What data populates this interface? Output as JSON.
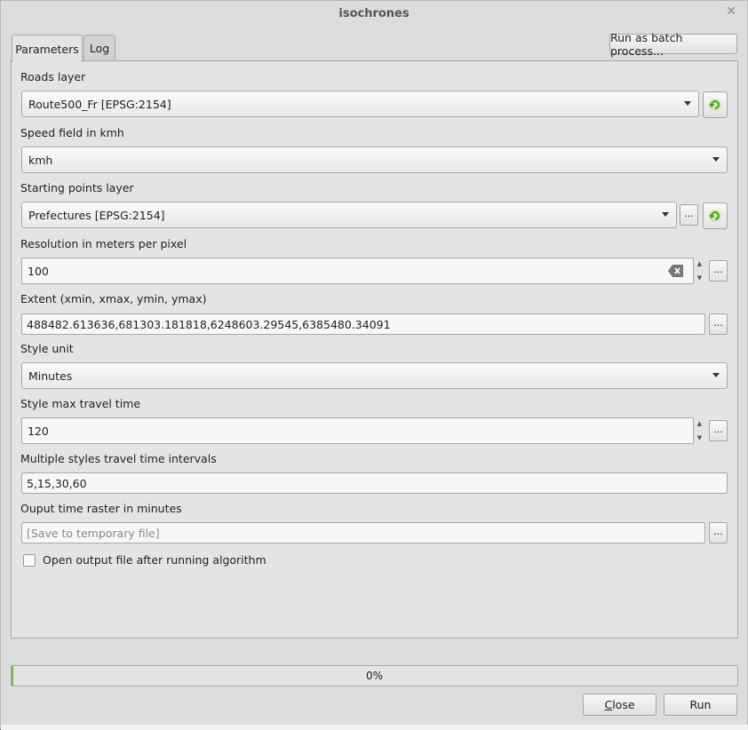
{
  "window": {
    "title": "isochrones"
  },
  "tabs": [
    {
      "label": "Parameters"
    },
    {
      "label": "Log"
    }
  ],
  "toolbar": {
    "batch_label": "Run as batch process..."
  },
  "params": {
    "roads": {
      "label": "Roads layer",
      "value": "Route500_Fr [EPSG:2154]"
    },
    "speed": {
      "label": "Speed field in kmh",
      "value": "kmh"
    },
    "start": {
      "label": "Starting points layer",
      "value": "Prefectures [EPSG:2154]"
    },
    "resolution": {
      "label": "Resolution in meters per pixel",
      "value": "100"
    },
    "extent": {
      "label": "Extent (xmin, xmax, ymin, ymax)",
      "value": "488482.613636,681303.181818,6248603.29545,6385480.34091"
    },
    "style_unit": {
      "label": "Style unit",
      "value": "Minutes"
    },
    "max_time": {
      "label": "Style max travel time",
      "value": "120"
    },
    "intervals": {
      "label": "Multiple styles travel time intervals",
      "value": "5,15,30,60"
    },
    "output": {
      "label": "Ouput time raster in minutes",
      "placeholder": "[Save to temporary file]"
    },
    "open_output": {
      "label": "Open output file after running algorithm",
      "checked": false
    }
  },
  "dots_label": "...",
  "progress": {
    "text": "0%",
    "value": 0
  },
  "buttons": {
    "close_label": "Close",
    "close_mnemonic": "C",
    "close_rest": "lose",
    "run_label": "Run"
  },
  "colors": {
    "accent": "#7ab04d",
    "refresh_icon": "#4e9a1e"
  },
  "icons": {
    "refresh": "refresh-icon",
    "clear": "clear-input-icon",
    "dropdown": "chevron-down-icon"
  }
}
